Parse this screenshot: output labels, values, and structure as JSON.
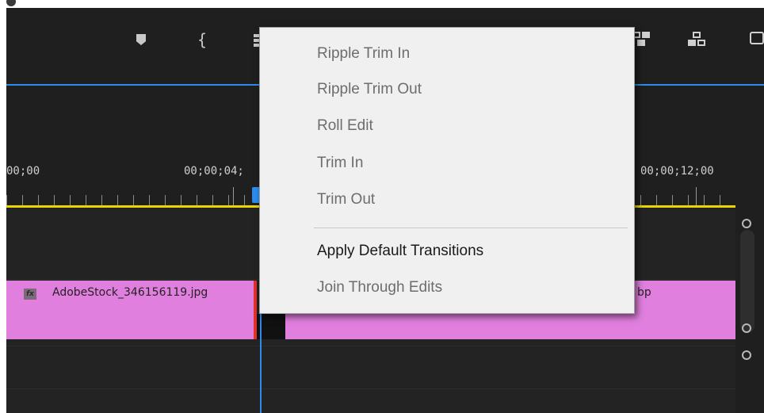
{
  "timeline": {
    "timecodes": [
      "00;00",
      "00;00;04;",
      "00;00;12;00"
    ],
    "clip_a_name": "AdobeStock_346156119.jpg",
    "clip_b_fragment": "bp",
    "fx_badge": "fx"
  },
  "context_menu": {
    "items": [
      {
        "label": "Ripple Trim In",
        "enabled": false
      },
      {
        "label": "Ripple Trim Out",
        "enabled": false
      },
      {
        "label": "Roll Edit",
        "enabled": false
      },
      {
        "label": "Trim In",
        "enabled": false
      },
      {
        "label": "Trim Out",
        "enabled": false
      },
      {
        "label": "Apply Default Transitions",
        "enabled": true
      },
      {
        "label": "Join Through Edits",
        "enabled": false
      }
    ]
  },
  "colors": {
    "playhead": "#2d8ceb",
    "work_area": "#e8d800",
    "clip": "#e07fde",
    "edit_point": "#e0322b"
  },
  "icons": [
    "marker-icon",
    "brace-icon",
    "snap-icon",
    "lift-icon",
    "extract-icon",
    "camera-icon"
  ]
}
